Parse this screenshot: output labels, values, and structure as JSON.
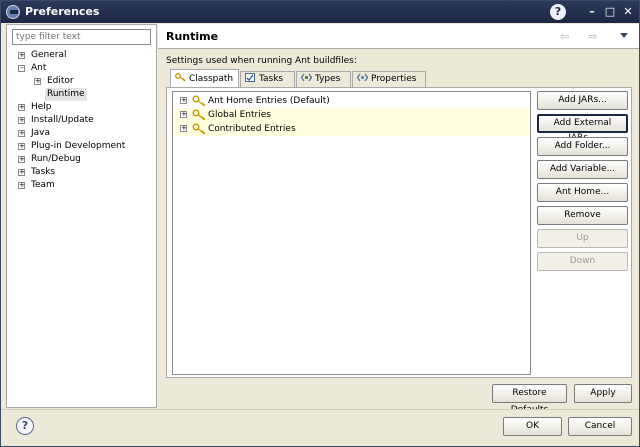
{
  "window": {
    "title": "Preferences"
  },
  "filter": {
    "placeholder": "type filter text"
  },
  "tree": [
    {
      "label": "General",
      "expander": "+"
    },
    {
      "label": "Ant",
      "expander": "-"
    },
    {
      "label": "Editor",
      "expander": "+"
    },
    {
      "label": "Runtime",
      "expander": ""
    },
    {
      "label": "Help",
      "expander": "+"
    },
    {
      "label": "Install/Update",
      "expander": "+"
    },
    {
      "label": "Java",
      "expander": "+"
    },
    {
      "label": "Plug-in Development",
      "expander": "+"
    },
    {
      "label": "Run/Debug",
      "expander": "+"
    },
    {
      "label": "Tasks",
      "expander": "+"
    },
    {
      "label": "Team",
      "expander": "+"
    }
  ],
  "page": {
    "title": "Runtime",
    "description": "Settings used when running Ant buildfiles:",
    "back_glyph": "⇦",
    "forward_glyph": "⇨"
  },
  "tabs": [
    {
      "label": "Classpath",
      "icon": "classpath-icon",
      "active": true
    },
    {
      "label": "Tasks",
      "icon": "tasks-icon",
      "active": false
    },
    {
      "label": "Types",
      "icon": "types-icon",
      "active": false
    },
    {
      "label": "Properties",
      "icon": "properties-icon",
      "active": false
    }
  ],
  "classpath": {
    "entries": [
      {
        "label": "Ant Home Entries (Default)",
        "expander": "+"
      },
      {
        "label": "Global Entries",
        "expander": "+"
      },
      {
        "label": "Contributed Entries",
        "expander": "+"
      }
    ],
    "buttons": [
      {
        "label": "Add JARs...",
        "enabled": true
      },
      {
        "label": "Add External JARs...",
        "enabled": true,
        "focused": true
      },
      {
        "label": "Add Folder...",
        "enabled": true
      },
      {
        "label": "Add Variable...",
        "enabled": true
      },
      {
        "label": "Ant Home...",
        "enabled": true
      },
      {
        "label": "Remove",
        "enabled": true
      },
      {
        "label": "Up",
        "enabled": false
      },
      {
        "label": "Down",
        "enabled": false
      }
    ]
  },
  "footer": {
    "restore_defaults": "Restore Defaults",
    "apply": "Apply",
    "ok": "OK",
    "cancel": "Cancel",
    "help_glyph": "?"
  },
  "titlebar_buttons": {
    "help": "?",
    "minimize": "–",
    "maximize": "□",
    "close": "✕"
  },
  "colors": {
    "titlebar": "#1c2742",
    "key_icon": "#c79a00",
    "entry_highlight": "#ffffe0"
  }
}
